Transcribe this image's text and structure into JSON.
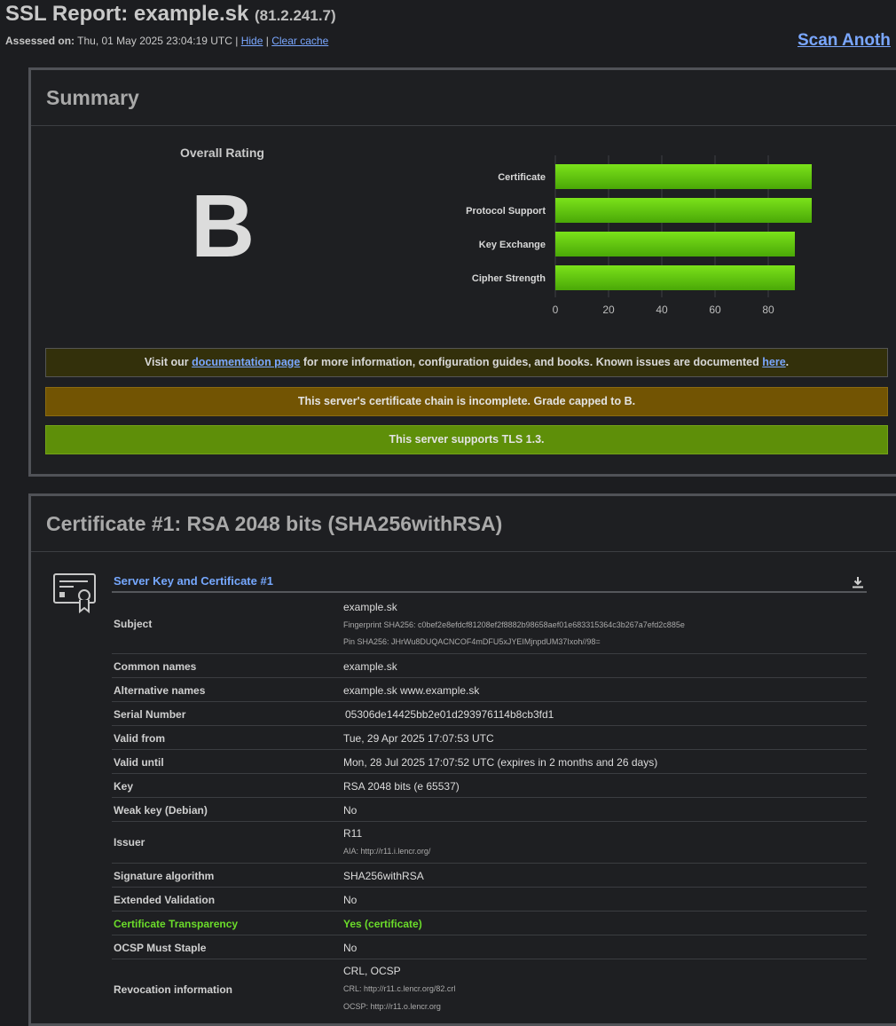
{
  "header": {
    "title": "SSL Report: example.sk",
    "ip": "(81.2.241.7)",
    "assessed_label": "Assessed on:",
    "assessed_value": "Thu, 01 May 2025 23:04:19 UTC |",
    "hide_link": "Hide",
    "sep": "|",
    "clear_cache_link": "Clear cache",
    "scan_another": "Scan Anoth"
  },
  "summary": {
    "heading": "Summary",
    "overall_rating_label": "Overall Rating",
    "grade": "B",
    "notices": {
      "doc_pre": "Visit our ",
      "doc_link": "documentation page",
      "doc_mid": " for more information, configuration guides, and books. Known issues are documented ",
      "doc_here": "here",
      "doc_post": ".",
      "chain": "This server's certificate chain is incomplete. Grade capped to B.",
      "tls13": "This server supports TLS 1.3."
    }
  },
  "chart_data": {
    "type": "bar",
    "orientation": "horizontal",
    "categories": [
      "Certificate",
      "Protocol Support",
      "Key Exchange",
      "Cipher Strength"
    ],
    "values": [
      100,
      100,
      90,
      90
    ],
    "xlim": [
      0,
      100
    ],
    "xticks": [
      0,
      20,
      40,
      60,
      80,
      100
    ],
    "bar_color": "#5fc40c",
    "grid": true
  },
  "certificate": {
    "heading": "Certificate #1: RSA 2048 bits (SHA256withRSA)",
    "subheading": "Server Key and Certificate #1",
    "icon": "certificate-icon",
    "download_icon": "download-icon",
    "subject_name": "example.sk",
    "fingerprint": "Fingerprint SHA256: c0bef2e8efdcf81208ef2f8882b98658aef01e683315364c3b267a7efd2c885e",
    "pin": "Pin SHA256: JHrWu8DUQACNCOF4mDFU5xJYEIMjnpdUM37Ixoh//98=",
    "rows": {
      "subject": "Subject",
      "common_names_label": "Common names",
      "common_names": "example.sk",
      "alt_names_label": "Alternative names",
      "alt_names": "example.sk www.example.sk",
      "serial_label": "Serial Number",
      "serial": "05306de14425bb2e01d293976114b8cb3fd1",
      "valid_from_label": "Valid from",
      "valid_from": "Tue, 29 Apr 2025 17:07:53 UTC",
      "valid_until_label": "Valid until",
      "valid_until": "Mon, 28 Jul 2025 17:07:52 UTC (expires in 2 months and 26 days)",
      "key_label": "Key",
      "key": "RSA 2048 bits (e 65537)",
      "weak_key_label": "Weak key (Debian)",
      "weak_key": "No",
      "issuer_label": "Issuer",
      "issuer": "R11",
      "issuer_aia": "AIA: http://r11.i.lencr.org/",
      "sig_alg_label": "Signature algorithm",
      "sig_alg": "SHA256withRSA",
      "ev_label": "Extended Validation",
      "ev": "No",
      "ct_label": "Certificate Transparency",
      "ct": "Yes (certificate)",
      "ocsp_staple_label": "OCSP Must Staple",
      "ocsp_staple": "No",
      "revocation_label": "Revocation information",
      "revocation": "CRL, OCSP",
      "crl": "CRL: http://r11.c.lencr.org/82.crl",
      "ocsp": "OCSP: http://r11.o.lencr.org"
    }
  }
}
